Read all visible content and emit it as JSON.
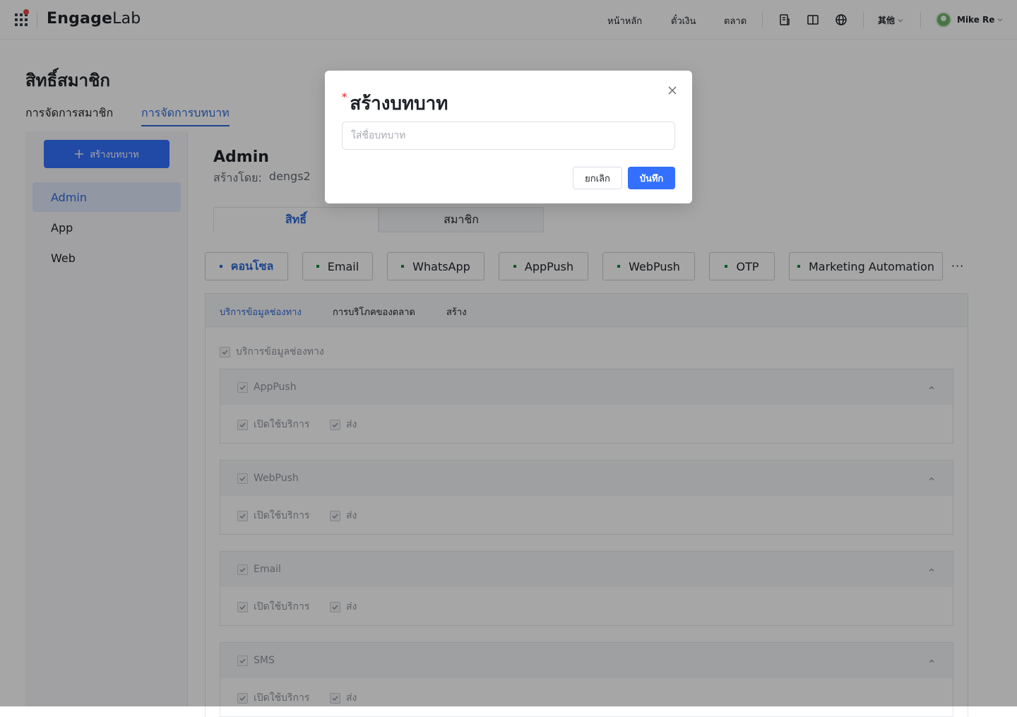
{
  "topnav": {
    "brand_main": "Engage",
    "brand_suffix": "Lab",
    "links": [
      "หน้าหลัก",
      "ตั๋วเงิน",
      "ตลาด"
    ],
    "language": "其他",
    "user_name": "Mike Re",
    "icons": [
      "apps-grid-icon",
      "document-icon",
      "book-icon",
      "globe-icon"
    ]
  },
  "page": {
    "title": "สิทธิ์สมาชิก",
    "tabs": [
      "การจัดการสมาชิก",
      "การจัดการบทบาท"
    ],
    "active_tab": 1
  },
  "sidebar": {
    "create_button": "สร้างบทบาท",
    "roles": [
      "Admin",
      "App",
      "Web"
    ],
    "active_role": 0
  },
  "role": {
    "title": "Admin",
    "created_by_label": "สร้างโดย:",
    "created_by_value": "dengs2",
    "subtabs": [
      "สิทธิ์",
      "สมาชิก"
    ],
    "active_subtab": 0
  },
  "channels": {
    "items": [
      "คอนโซล",
      "Email",
      "WhatsApp",
      "AppPush",
      "WebPush",
      "OTP",
      "Marketing Automation"
    ],
    "active": 0,
    "more": "···"
  },
  "permissions": {
    "tabs": [
      "บริการข้อมูลช่องทาง",
      "การบริโภคของตลาด",
      "สร้าง"
    ],
    "active_tab": 0,
    "root_label": "บริการข้อมูลช่องทาง",
    "services": [
      {
        "name": "AppPush",
        "perms": [
          "เปิดใช้บริการ",
          "ส่ง"
        ]
      },
      {
        "name": "WebPush",
        "perms": [
          "เปิดใช้บริการ",
          "ส่ง"
        ]
      },
      {
        "name": "Email",
        "perms": [
          "เปิดใช้บริการ",
          "ส่ง"
        ]
      },
      {
        "name": "SMS",
        "perms": [
          "เปิดใช้บริการ",
          "ส่ง"
        ]
      }
    ]
  },
  "modal": {
    "title": "สร้างบทบาท",
    "required_mark": "*",
    "input_value": "",
    "input_placeholder": "ใส่ชื่อบทบาท",
    "cancel_label": "ยกเลิก",
    "save_label": "บันทึก"
  },
  "colors": {
    "primary": "#3370ff",
    "active_text": "#2e6bd8",
    "channel_dot": "#0b8a3e",
    "required": "#f54a45",
    "overlay": "rgba(0,0,0,0.35)"
  }
}
